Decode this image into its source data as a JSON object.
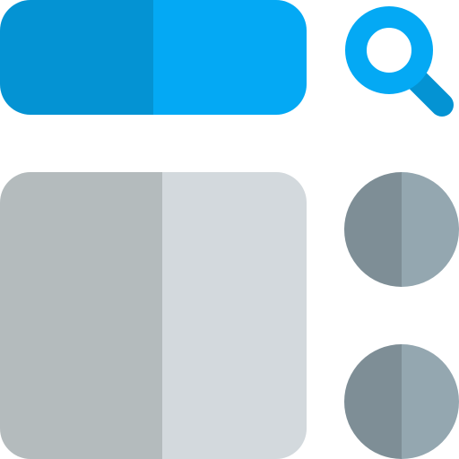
{
  "colors": {
    "search_bar_left": "#0493d3",
    "search_bar_right": "#04a9f4",
    "search_icon_light": "#04a9f4",
    "search_icon_dark": "#0493d3",
    "panel_left": "#b4bbbd",
    "panel_right": "#d3d9dd",
    "dot_left": "#7e8e96",
    "dot_right": "#94a7b0",
    "background": "#ffffff"
  },
  "icons": {
    "search": "search-icon",
    "list_dot_1": "circle-icon",
    "list_dot_2": "circle-icon"
  }
}
